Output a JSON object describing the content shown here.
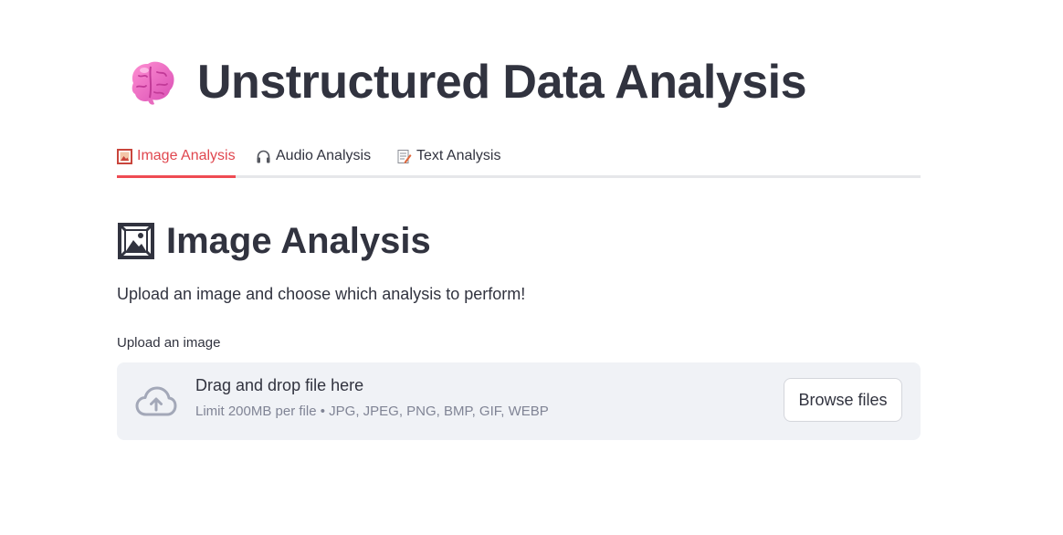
{
  "app": {
    "title": "Unstructured Data Analysis",
    "icon": "brain-icon"
  },
  "tabs": [
    {
      "label": "Image Analysis",
      "icon": "framed-picture-icon",
      "active": true
    },
    {
      "label": "Audio Analysis",
      "icon": "headphones-icon",
      "active": false
    },
    {
      "label": "Text Analysis",
      "icon": "memo-icon",
      "active": false
    }
  ],
  "section": {
    "title": "Image Analysis",
    "icon": "framed-picture-icon",
    "description": "Upload an image and choose which analysis to perform!"
  },
  "uploader": {
    "label": "Upload an image",
    "drop_text": "Drag and drop file here",
    "limit_text": "Limit 200MB per file • JPG, JPEG, PNG, BMP, GIF, WEBP",
    "button_label": "Browse files",
    "icon": "cloud-upload-icon"
  },
  "colors": {
    "accent": "#ef4b53",
    "text": "#31333f",
    "muted": "#808495",
    "dropzone_bg": "#f0f2f6"
  }
}
